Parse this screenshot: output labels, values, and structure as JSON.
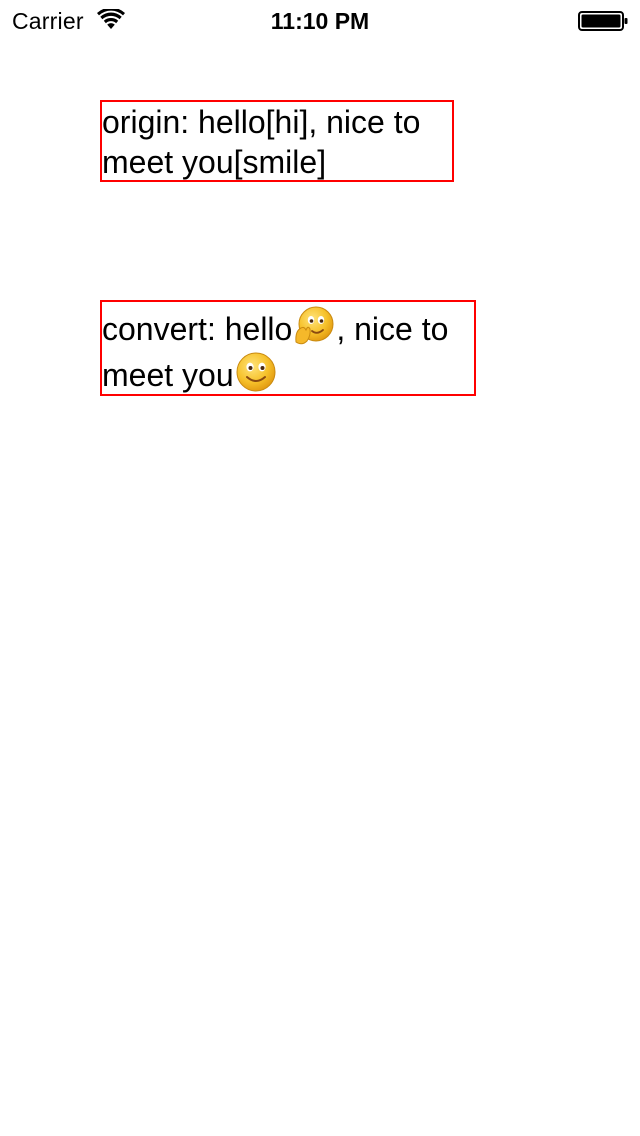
{
  "status_bar": {
    "carrier": "Carrier",
    "time": "11:10 PM",
    "wifi_icon": "wifi-icon",
    "battery_icon": "battery-full-icon"
  },
  "origin": {
    "line1": "origin: hello[hi], nice to",
    "line2": "meet you[smile]"
  },
  "convert": {
    "line1_prefix": "convert: hello",
    "line1_emoji": "waving-hi-emoji-icon",
    "line1_suffix": ", nice to",
    "line2_prefix": "meet you",
    "line2_emoji": "smile-emoji-icon"
  },
  "colors": {
    "box_border": "#ff0000",
    "emoji_face": "#f6c12a",
    "text": "#000000"
  }
}
